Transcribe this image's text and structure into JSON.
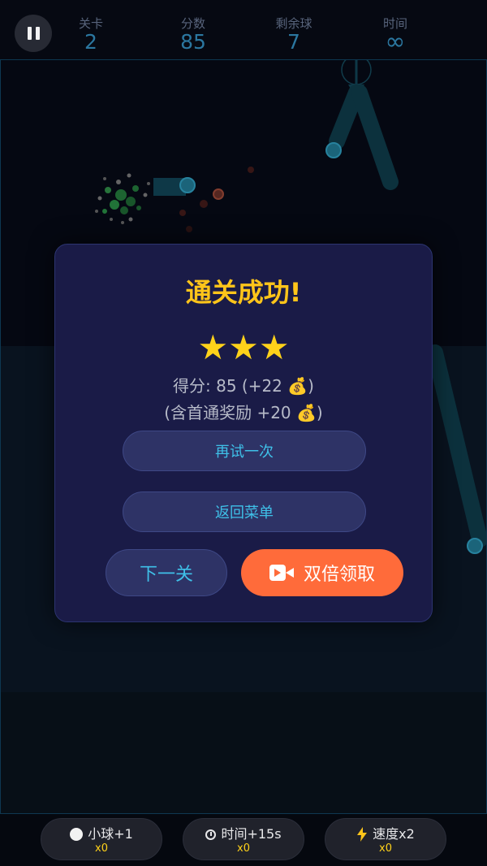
{
  "hud": {
    "level_label": "关卡",
    "level_value": "2",
    "score_label": "分数",
    "score_value": "85",
    "balls_label": "剩余球",
    "balls_value": "7",
    "time_label": "时间",
    "time_value": "∞"
  },
  "modal": {
    "title": "通关成功!",
    "stars": "★★★",
    "star_count": 3,
    "score_line": "得分: 85 (+22 💰)",
    "bonus_line": "(含首通奖励 +20 💰)",
    "retry_label": "再试一次",
    "menu_label": "返回菜单",
    "next_label": "下一关",
    "double_label": "双倍领取"
  },
  "powerups": [
    {
      "name": "小球+1",
      "count": "x0",
      "icon": "ball-icon"
    },
    {
      "name": "时间+15s",
      "count": "x0",
      "icon": "timer-icon"
    },
    {
      "name": "速度x2",
      "count": "x0",
      "icon": "lightning-icon"
    }
  ],
  "colors": {
    "accent_cyan": "#3fc0e8",
    "title_gold": "#ffc51a",
    "double_orange": "#ff6b3a",
    "modal_bg": "#1a1b47"
  }
}
